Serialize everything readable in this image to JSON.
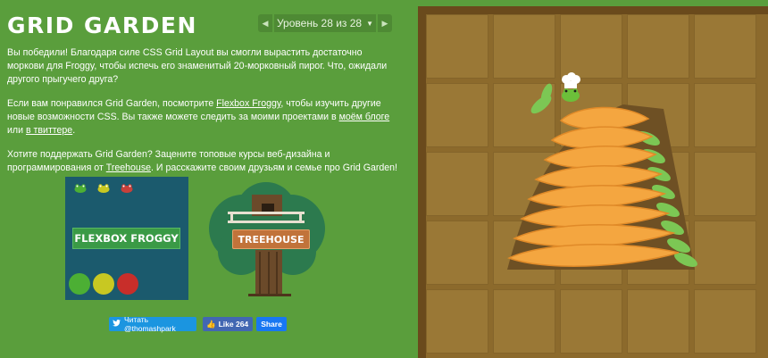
{
  "header": {
    "title": "GRID GARDEN",
    "level_text": "Уровень 28 из 28",
    "prev_icon": "triangle-left-icon",
    "next_icon": "triangle-right-icon",
    "dropdown_icon": "caret-down-icon"
  },
  "instructions": {
    "p1": "Вы победили! Благодаря силе CSS Grid Layout вы смогли вырастить достаточно моркови для Froggy, чтобы испечь его знаменитый 20-морковный пирог. Что, ожидали другого прыгучего друга?",
    "p2_start": "Если вам понравился Grid Garden, посмотрите ",
    "p2_link1": "Flexbox Froggy",
    "p2_mid": ", чтобы изучить другие новые возможности CSS. Вы также можете следить за моими проектами в ",
    "p2_link2": "моём блоге",
    "p2_or": " или ",
    "p2_link3": "в твиттере",
    "p2_end": ".",
    "p3_start": "Хотите поддержать Grid Garden? Зацените топовые курсы веб-дизайна и программирования от ",
    "p3_link": "Treehouse",
    "p3_end": ". И расскажите своим друзьям и семье про Grid Garden!"
  },
  "promos": {
    "froggy_label": "FLEXBOX FROGGY",
    "treehouse_label": "TREEHOUSE"
  },
  "social": {
    "twitter_label": "Читать @thomashpark",
    "like_label": "Like 264",
    "share_label": "Share"
  },
  "colors": {
    "background": "#5a9e3c",
    "soil": "#9a7836",
    "carrot": "#f4a640",
    "leaf": "#7cc754",
    "frog": "#6cbf3a"
  }
}
